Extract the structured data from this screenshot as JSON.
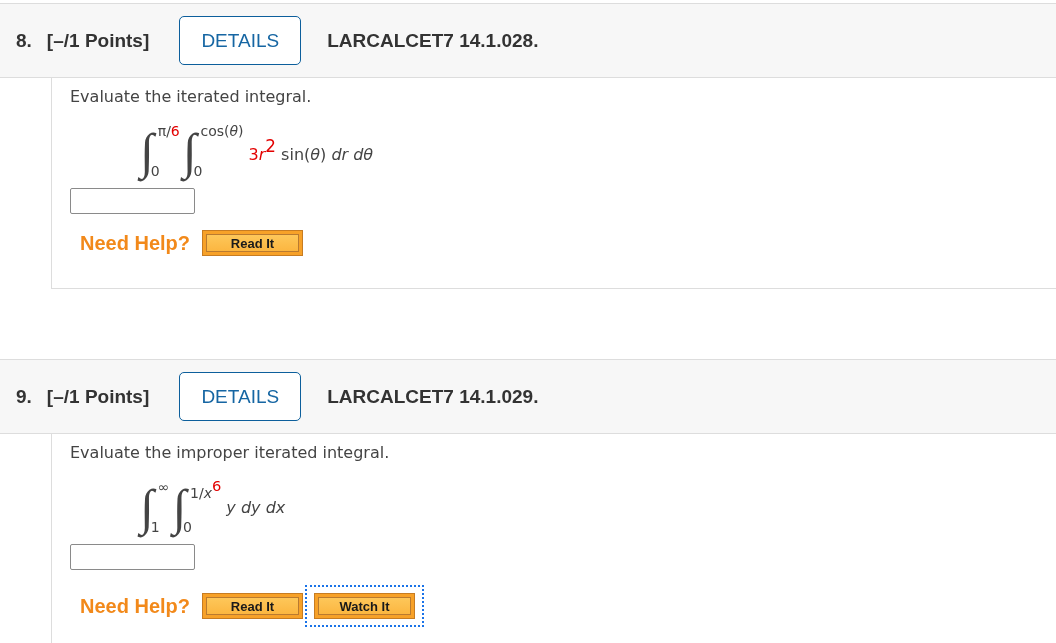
{
  "questions": [
    {
      "number": "8.",
      "points": "[–/1 Points]",
      "details_button": "DETAILS",
      "reference": "LARCALCET7 14.1.028.",
      "prompt": "Evaluate the iterated integral.",
      "integral": {
        "integrals": [
          {
            "sign": "∫",
            "upper": [
              {
                "text": "π/",
                "kind": "plain",
                "color": "#444444"
              },
              {
                "text": "6",
                "kind": "plain",
                "color": "#e30000"
              }
            ],
            "lower": "0"
          },
          {
            "sign": "∫",
            "upper": [
              {
                "text": "cos(*θ*)",
                "kind": "plain",
                "color": "#444444"
              }
            ],
            "lower": "0"
          }
        ],
        "integrand": [
          {
            "text": "3",
            "kind": "plain",
            "color": "#e30000"
          },
          {
            "text": "r",
            "kind": "italic",
            "color": "#e30000"
          },
          {
            "text": "2",
            "kind": "sup",
            "color": "#e30000"
          },
          {
            "text": " sin(*θ*) *dr dθ*",
            "kind": "plain",
            "color": "#444444"
          }
        ]
      },
      "help": {
        "label": "Need Help?",
        "buttons": [
          {
            "label": "Read It",
            "focused": false
          }
        ]
      }
    },
    {
      "number": "9.",
      "points": "[–/1 Points]",
      "details_button": "DETAILS",
      "reference": "LARCALCET7 14.1.029.",
      "prompt": "Evaluate the improper iterated integral.",
      "integral": {
        "integrals": [
          {
            "sign": "∫",
            "upper": [
              {
                "text": "∞",
                "kind": "plain",
                "color": "#444444"
              }
            ],
            "lower": "1"
          },
          {
            "sign": "∫",
            "upper": [
              {
                "text": "1/",
                "kind": "plain",
                "color": "#444444"
              },
              {
                "text": "x",
                "kind": "italic",
                "color": "#444444"
              },
              {
                "text": "6",
                "kind": "sup",
                "color": "#e30000"
              }
            ],
            "lower": "0"
          }
        ],
        "integrand": [
          {
            "text": "y dy dx",
            "kind": "italic",
            "color": "#444444"
          }
        ]
      },
      "help": {
        "label": "Need Help?",
        "buttons": [
          {
            "label": "Read It",
            "focused": false
          },
          {
            "label": "Watch It",
            "focused": true
          }
        ]
      }
    }
  ]
}
